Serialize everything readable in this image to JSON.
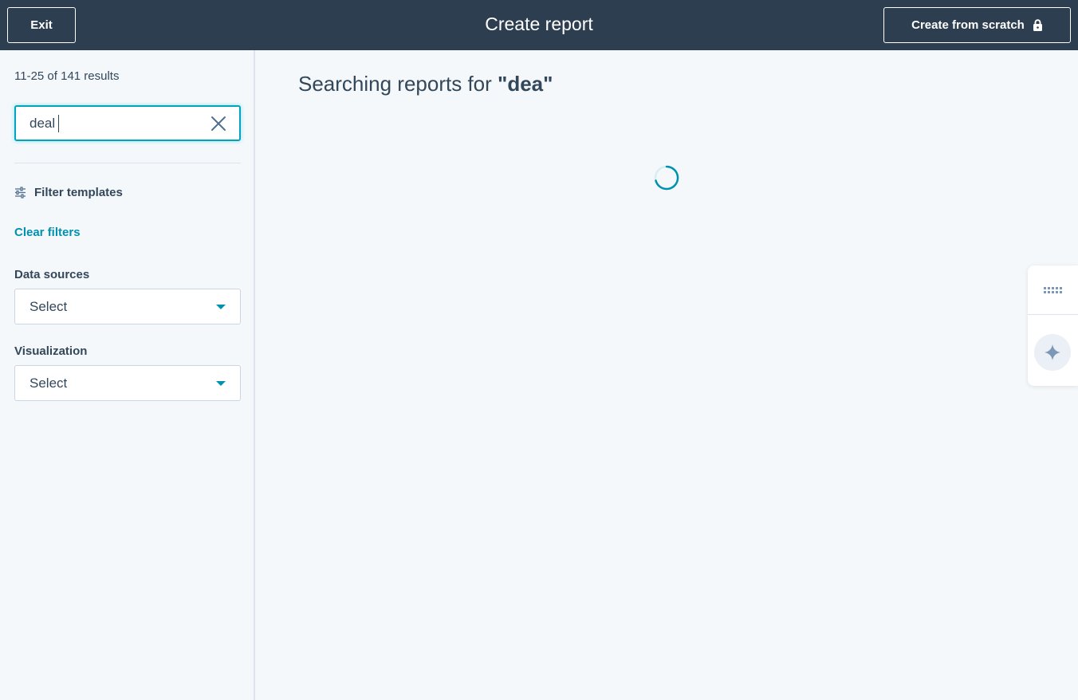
{
  "header": {
    "exit_label": "Exit",
    "title": "Create report",
    "create_from_scratch_label": "Create from scratch",
    "lock_icon": "lock-icon"
  },
  "sidebar": {
    "results_count": "11-25 of 141 results",
    "search": {
      "value": "deal",
      "clear_icon": "close-icon"
    },
    "filter_heading": "Filter templates",
    "filter_icon": "sliders-icon",
    "clear_filters_label": "Clear filters",
    "data_sources": {
      "label": "Data sources",
      "value": "Select"
    },
    "visualization": {
      "label": "Visualization",
      "value": "Select"
    }
  },
  "main": {
    "heading_prefix": "Searching reports for ",
    "heading_query": "\"dea\"",
    "loading_icon": "spinner-icon"
  },
  "side_tools": {
    "grid_icon": "grid-icon",
    "ai_icon": "sparkle-icon"
  },
  "colors": {
    "header_bg": "#2d3e50",
    "accent": "#00a4bd",
    "link": "#0091ae",
    "text": "#33475b",
    "page_bg": "#f5f8fa"
  }
}
